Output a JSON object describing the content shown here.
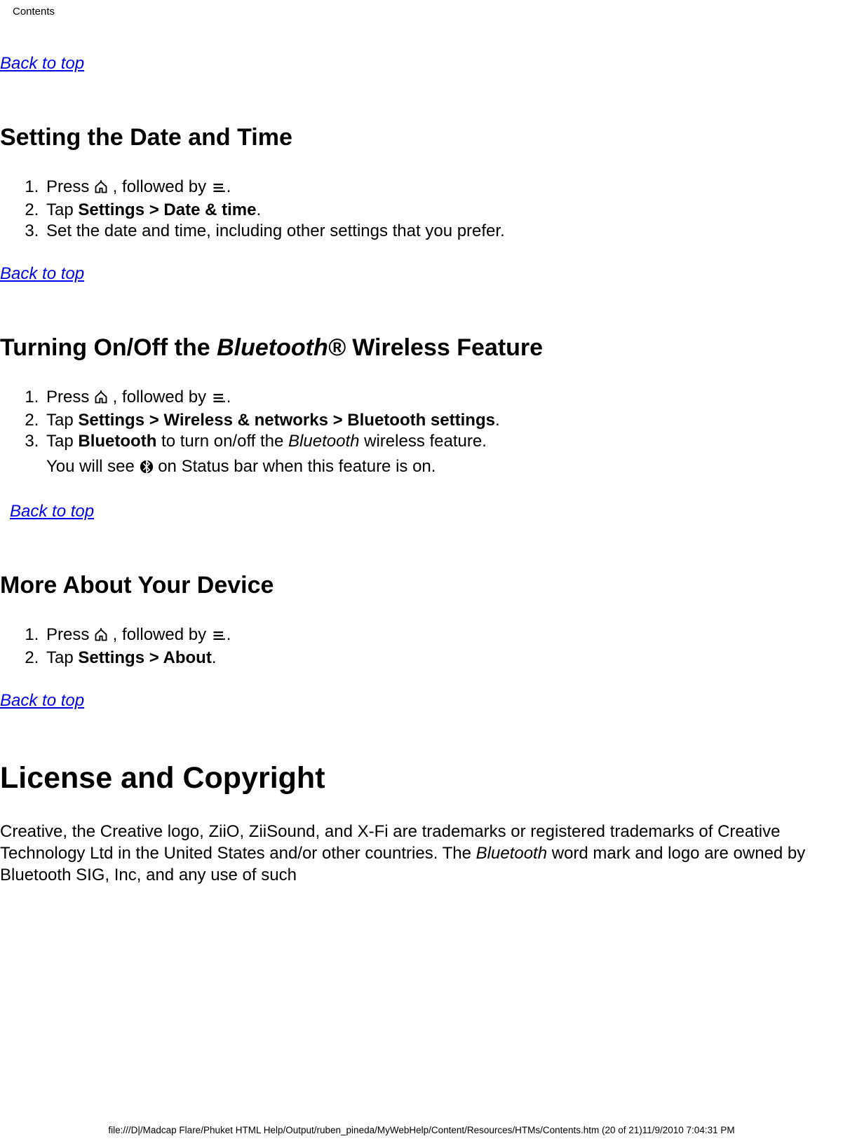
{
  "header": {
    "title": "Contents"
  },
  "links": {
    "back_to_top": "Back to top"
  },
  "icons": {
    "home_alt": "Home icon",
    "menu_alt": "Menu icon",
    "bt_alt": "Bluetooth icon"
  },
  "section_date": {
    "heading": "Setting the Date and Time",
    "step1_a": "Press ",
    "step1_b": " , followed by ",
    "step1_c": ".",
    "step2_a": "Tap ",
    "step2_bold": "Settings > Date & time",
    "step2_c": ".",
    "step3": "Set the date and time, including other settings that you prefer."
  },
  "section_bt": {
    "heading_a": "Turning On/Off the ",
    "heading_i": "Bluetooth®",
    "heading_b": " Wireless Feature",
    "step1_a": "Press ",
    "step1_b": " , followed by ",
    "step1_c": ".",
    "step2_a": "Tap ",
    "step2_bold": "Settings > Wireless & networks > Bluetooth settings",
    "step2_c": ".",
    "step3_a": "Tap ",
    "step3_bold": "Bluetooth",
    "step3_b": " to turn on/off the ",
    "step3_i": "Bluetooth",
    "step3_c": " wireless feature.",
    "step3_sub_a": "You will see ",
    "step3_sub_b": " on Status bar when this feature is on."
  },
  "section_more": {
    "heading": "More About Your Device",
    "step1_a": "Press ",
    "step1_b": " , followed by ",
    "step1_c": ".",
    "step2_a": "Tap ",
    "step2_bold": "Settings > About",
    "step2_c": "."
  },
  "section_license": {
    "heading": "License and Copyright",
    "para_a": "Creative, the Creative logo, ZiiO, ZiiSound, and X-Fi are trademarks or registered trademarks of Creative Technology Ltd in the United States and/or other countries. The ",
    "para_i": "Bluetooth",
    "para_b": " word mark and logo are owned by Bluetooth SIG, Inc, and any use of such"
  },
  "footer": "file:///D|/Madcap Flare/Phuket HTML Help/Output/ruben_pineda/MyWebHelp/Content/Resources/HTMs/Contents.htm (20 of 21)11/9/2010 7:04:31 PM"
}
